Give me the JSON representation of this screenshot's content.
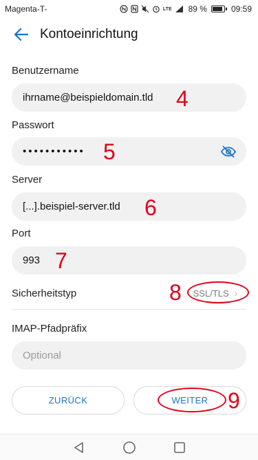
{
  "status_bar": {
    "carrier": "Magenta-T-",
    "signal_text": "LTE",
    "battery": "89 %",
    "battery_level": 0.89,
    "time": "09:59"
  },
  "header": {
    "title": "Kontoeinrichtung"
  },
  "form": {
    "username": {
      "label": "Benutzername",
      "value": "ihrname@beispieldomain.tld",
      "marker": "4"
    },
    "password": {
      "label": "Passwort",
      "value": "•••••••••••",
      "marker": "5"
    },
    "server": {
      "label": "Server",
      "value": "[...].beispiel-server.tld",
      "marker": "6"
    },
    "port": {
      "label": "Port",
      "value": "993",
      "marker": "7"
    },
    "security": {
      "label": "Sicherheitstyp",
      "value": "SSL/TLS",
      "marker": "8"
    },
    "imap_prefix": {
      "label": "IMAP-Pfadpräfix",
      "placeholder": "Optional"
    }
  },
  "buttons": {
    "back_label": "ZURÜCK",
    "next_label": "WEITER",
    "next_marker": "9"
  },
  "colors": {
    "accent": "#1a73c9",
    "annotation": "#e0001a",
    "field_bg": "#f1f1f1"
  },
  "icons": {
    "back": "arrow-left-icon",
    "eye": "eye-off-icon",
    "nav": [
      "nav-back-icon",
      "nav-home-icon",
      "nav-recents-icon"
    ]
  }
}
